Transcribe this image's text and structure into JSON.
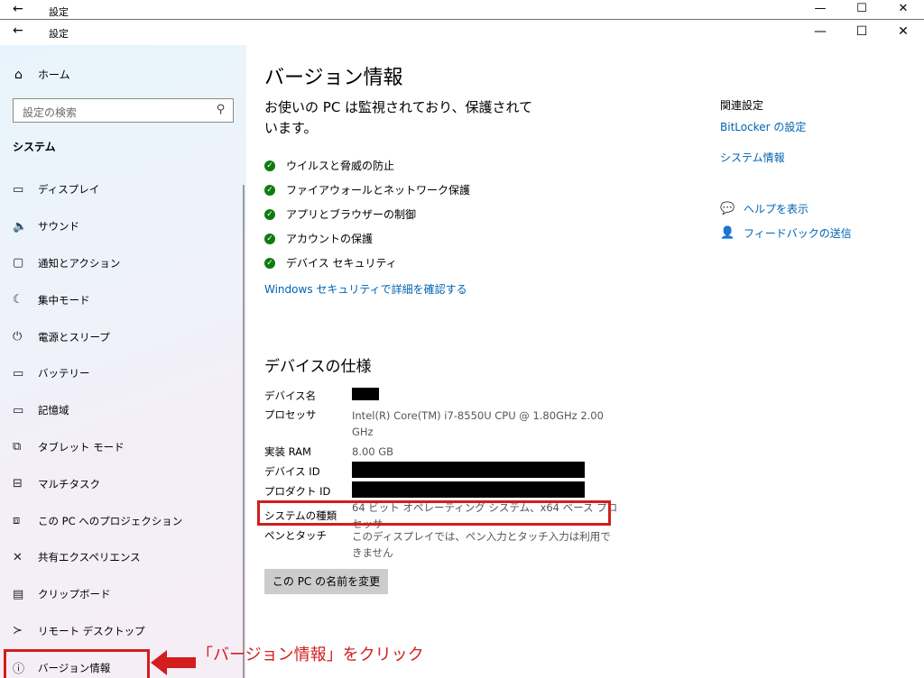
{
  "window": {
    "title": "設定",
    "back_icon": "←",
    "min_icon": "—",
    "max_icon": "☐",
    "close_icon": "✕"
  },
  "sidebar": {
    "home_label": "ホーム",
    "search_placeholder": "設定の検索",
    "section_title": "システム",
    "items": [
      {
        "label": "ディスプレイ",
        "icon": "▭"
      },
      {
        "label": "サウンド",
        "icon": "🔈"
      },
      {
        "label": "通知とアクション",
        "icon": "▢"
      },
      {
        "label": "集中モード",
        "icon": "☾"
      },
      {
        "label": "電源とスリープ",
        "icon": "⏻"
      },
      {
        "label": "バッテリー",
        "icon": "▭"
      },
      {
        "label": "記憶域",
        "icon": "▭"
      },
      {
        "label": "タブレット モード",
        "icon": "⧉"
      },
      {
        "label": "マルチタスク",
        "icon": "⊟"
      },
      {
        "label": "この PC へのプロジェクション",
        "icon": "⧈"
      },
      {
        "label": "共有エクスペリエンス",
        "icon": "✕"
      },
      {
        "label": "クリップボード",
        "icon": "▤"
      },
      {
        "label": "リモート デスクトップ",
        "icon": "≻"
      },
      {
        "label": "バージョン情報",
        "icon": "ⓘ"
      }
    ]
  },
  "main": {
    "title": "バージョン情報",
    "protection_text": "お使いの PC は監視されており、保護されています。",
    "protection_items": [
      "ウイルスと脅威の防止",
      "ファイアウォールとネットワーク保護",
      "アプリとブラウザーの制御",
      "アカウントの保護",
      "デバイス セキュリティ"
    ],
    "security_link": "Windows セキュリティで詳細を確認する",
    "spec_title": "デバイスの仕様",
    "specs": {
      "device_name_label": "デバイス名",
      "processor_label": "プロセッサ",
      "processor_value": "Intel(R) Core(TM) i7-8550U CPU @ 1.80GHz   2.00 GHz",
      "ram_label": "実装 RAM",
      "ram_value": "8.00 GB",
      "device_id_label": "デバイス ID",
      "product_id_label": "プロダクト ID",
      "system_type_label": "システムの種類",
      "system_type_value": "64 ビット オペレーティング システム、x64 ベース プロセッサ",
      "pen_label": "ペンとタッチ",
      "pen_value": "このディスプレイでは、ペン入力とタッチ入力は利用できません"
    },
    "rename_button": "この PC の名前を変更"
  },
  "related": {
    "title": "関連設定",
    "bitlocker_link": "BitLocker の設定",
    "sysinfo_link": "システム情報",
    "help_link": "ヘルプを表示",
    "feedback_link": "フィードバックの送信"
  },
  "annotation": {
    "text": "「バージョン情報」をクリック",
    "color": "#d21e1e"
  }
}
